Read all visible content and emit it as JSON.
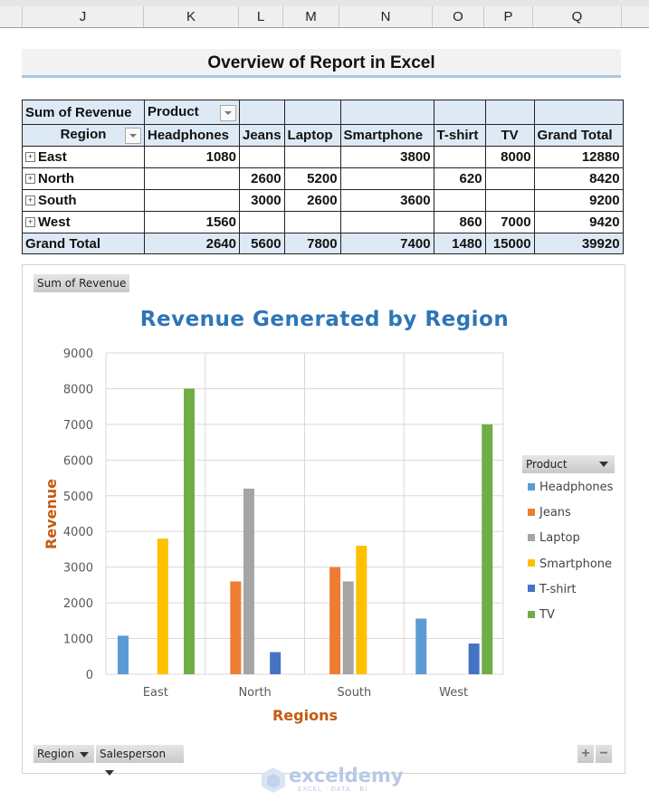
{
  "sheet": {
    "columns": [
      {
        "label": "J"
      },
      {
        "label": "K"
      },
      {
        "label": "L"
      },
      {
        "label": "M"
      },
      {
        "label": "N"
      },
      {
        "label": "O"
      },
      {
        "label": "P"
      },
      {
        "label": "Q"
      }
    ]
  },
  "report_title": "Overview of Report in Excel",
  "pivot": {
    "value_field": "Sum of Revenue",
    "column_field": "Product",
    "row_field": "Region",
    "columns": [
      "Headphones",
      "Jeans",
      "Laptop",
      "Smartphone",
      "T-shirt",
      "TV",
      "Grand Total"
    ],
    "rows": [
      {
        "label": "East",
        "values": [
          "1080",
          "",
          "",
          "3800",
          "",
          "8000",
          "12880"
        ]
      },
      {
        "label": "North",
        "values": [
          "",
          "2600",
          "5200",
          "",
          "620",
          "",
          "8420"
        ]
      },
      {
        "label": "South",
        "values": [
          "",
          "3000",
          "2600",
          "3600",
          "",
          "",
          "9200"
        ]
      },
      {
        "label": "West",
        "values": [
          "1560",
          "",
          "",
          "",
          "860",
          "7000",
          "9420"
        ]
      }
    ],
    "grand_total": {
      "label": "Grand Total",
      "values": [
        "2640",
        "5600",
        "7800",
        "7400",
        "1480",
        "15000",
        "39920"
      ]
    }
  },
  "pivot_chart": {
    "value_button": "Sum of Revenue",
    "legend_button": "Product",
    "axis_buttons": [
      "Region",
      "Salesperson"
    ],
    "zoom_in": "+",
    "zoom_out": "−"
  },
  "chart_data": {
    "type": "bar",
    "title": "Revenue Generated by Region",
    "xlabel": "Regions",
    "ylabel": "Revenue",
    "ylim": [
      0,
      9000
    ],
    "yticks": [
      "0",
      "1000",
      "2000",
      "3000",
      "4000",
      "5000",
      "6000",
      "7000",
      "8000",
      "9000"
    ],
    "grid": true,
    "legend_position": "right",
    "categories": [
      "East",
      "North",
      "South",
      "West"
    ],
    "series": [
      {
        "name": "Headphones",
        "color": "#5b9bd5",
        "values": [
          1080,
          null,
          null,
          1560
        ]
      },
      {
        "name": "Jeans",
        "color": "#ed7d31",
        "values": [
          null,
          2600,
          3000,
          null
        ]
      },
      {
        "name": "Laptop",
        "color": "#a5a5a5",
        "values": [
          null,
          5200,
          2600,
          null
        ]
      },
      {
        "name": "Smartphone",
        "color": "#ffc000",
        "values": [
          3800,
          null,
          3600,
          null
        ]
      },
      {
        "name": "T-shirt",
        "color": "#4472c4",
        "values": [
          null,
          620,
          null,
          860
        ]
      },
      {
        "name": "TV",
        "color": "#70ad47",
        "values": [
          8000,
          null,
          null,
          7000
        ]
      }
    ]
  },
  "watermark": {
    "brand": "exceldemy",
    "tagline": "EXCEL · DATA · BI"
  }
}
